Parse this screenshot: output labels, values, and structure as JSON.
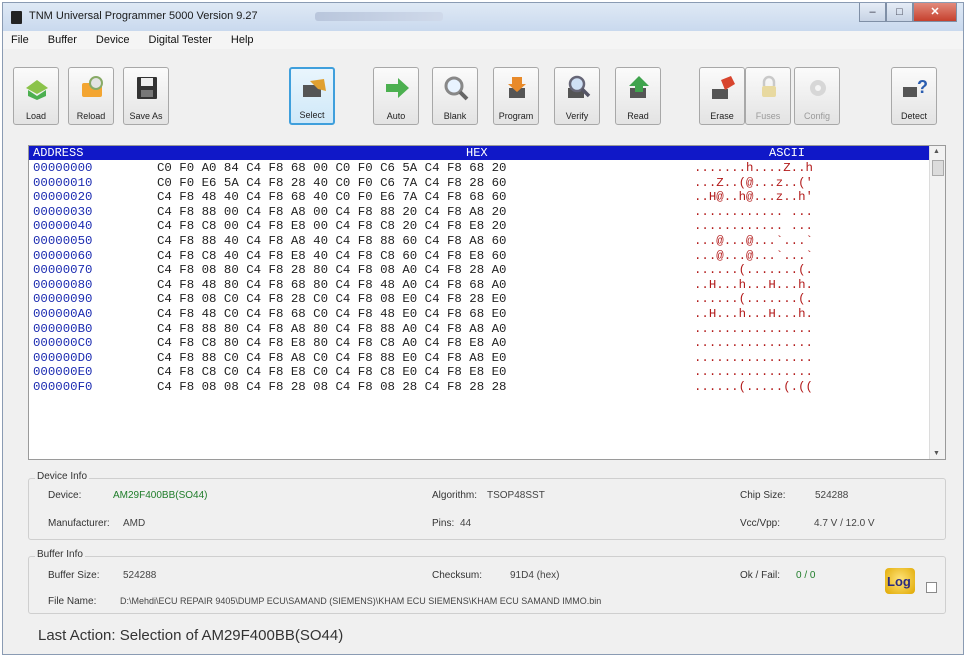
{
  "window": {
    "title": "TNM Universal Programmer 5000  Version 9.27",
    "controls": [
      "minimize",
      "maximize",
      "close"
    ]
  },
  "menu": [
    "File",
    "Buffer",
    "Device",
    "Digital Tester",
    "Help"
  ],
  "toolbar": [
    {
      "label": "Load",
      "icon": "load-icon",
      "enabled": true
    },
    {
      "label": "Reload",
      "icon": "reload-icon",
      "enabled": true
    },
    {
      "label": "Save As",
      "icon": "save-icon",
      "enabled": true
    },
    {
      "label": "Select",
      "icon": "select-chip-icon",
      "enabled": true,
      "active": true
    },
    {
      "label": "Auto",
      "icon": "arrow-right-icon",
      "enabled": true
    },
    {
      "label": "Blank",
      "icon": "magnifier-icon",
      "enabled": true
    },
    {
      "label": "Program",
      "icon": "program-icon",
      "enabled": true
    },
    {
      "label": "Verify",
      "icon": "verify-icon",
      "enabled": true
    },
    {
      "label": "Read",
      "icon": "read-icon",
      "enabled": true
    },
    {
      "label": "Erase",
      "icon": "erase-icon",
      "enabled": true
    },
    {
      "label": "Fuses",
      "icon": "lock-icon",
      "enabled": false
    },
    {
      "label": "Config",
      "icon": "gear-icon",
      "enabled": false
    },
    {
      "label": "Detect",
      "icon": "detect-icon",
      "enabled": true
    }
  ],
  "hex": {
    "headers": {
      "address": "ADDRESS",
      "hex": "HEX",
      "ascii": "ASCII"
    },
    "rows": [
      {
        "addr": "00000000",
        "hex": "C0 F0 A0 84 C4 F8 68 00 C0 F0 C6 5A C4 F8 68 20",
        "ascii": ".......h....Z..h"
      },
      {
        "addr": "00000010",
        "hex": "C0 F0 E6 5A C4 F8 28 40 C0 F0 C6 7A C4 F8 28 60",
        "ascii": "...Z..(@...z..('"
      },
      {
        "addr": "00000020",
        "hex": "C4 F8 48 40 C4 F8 68 40 C0 F0 E6 7A C4 F8 68 60",
        "ascii": "..H@..h@...z..h'"
      },
      {
        "addr": "00000030",
        "hex": "C4 F8 88 00 C4 F8 A8 00 C4 F8 88 20 C4 F8 A8 20",
        "ascii": "............ ..."
      },
      {
        "addr": "00000040",
        "hex": "C4 F8 C8 00 C4 F8 E8 00 C4 F8 C8 20 C4 F8 E8 20",
        "ascii": "............ ..."
      },
      {
        "addr": "00000050",
        "hex": "C4 F8 88 40 C4 F8 A8 40 C4 F8 88 60 C4 F8 A8 60",
        "ascii": "...@...@...`...`"
      },
      {
        "addr": "00000060",
        "hex": "C4 F8 C8 40 C4 F8 E8 40 C4 F8 C8 60 C4 F8 E8 60",
        "ascii": "...@...@...`...`"
      },
      {
        "addr": "00000070",
        "hex": "C4 F8 08 80 C4 F8 28 80 C4 F8 08 A0 C4 F8 28 A0",
        "ascii": "......(.......(."
      },
      {
        "addr": "00000080",
        "hex": "C4 F8 48 80 C4 F8 68 80 C4 F8 48 A0 C4 F8 68 A0",
        "ascii": "..H...h...H...h."
      },
      {
        "addr": "00000090",
        "hex": "C4 F8 08 C0 C4 F8 28 C0 C4 F8 08 E0 C4 F8 28 E0",
        "ascii": "......(.......(."
      },
      {
        "addr": "000000A0",
        "hex": "C4 F8 48 C0 C4 F8 68 C0 C4 F8 48 E0 C4 F8 68 E0",
        "ascii": "..H...h...H...h."
      },
      {
        "addr": "000000B0",
        "hex": "C4 F8 88 80 C4 F8 A8 80 C4 F8 88 A0 C4 F8 A8 A0",
        "ascii": "................"
      },
      {
        "addr": "000000C0",
        "hex": "C4 F8 C8 80 C4 F8 E8 80 C4 F8 C8 A0 C4 F8 E8 A0",
        "ascii": "................"
      },
      {
        "addr": "000000D0",
        "hex": "C4 F8 88 C0 C4 F8 A8 C0 C4 F8 88 E0 C4 F8 A8 E0",
        "ascii": "................"
      },
      {
        "addr": "000000E0",
        "hex": "C4 F8 C8 C0 C4 F8 E8 C0 C4 F8 C8 E0 C4 F8 E8 E0",
        "ascii": "................"
      },
      {
        "addr": "000000F0",
        "hex": "C4 F8 08 08 C4 F8 28 08 C4 F8 08 28 C4 F8 28 28",
        "ascii": "......(.....(.(("
      }
    ]
  },
  "device_info": {
    "group_label": "Device Info",
    "device_label": "Device:",
    "device": "AM29F400BB(SO44)",
    "manufacturer_label": "Manufacturer:",
    "manufacturer": "AMD",
    "algorithm_label": "Algorithm:",
    "algorithm": "TSOP48SST",
    "pins_label": "Pins:",
    "pins": "44",
    "chip_size_label": "Chip Size:",
    "chip_size": "524288",
    "vcc_label": "Vcc/Vpp:",
    "vcc": "4.7 V / 12.0 V"
  },
  "buffer_info": {
    "group_label": "Buffer Info",
    "buffer_size_label": "Buffer Size:",
    "buffer_size": "524288",
    "checksum_label": "Checksum:",
    "checksum": "91D4 (hex)",
    "okfail_label": "Ok / Fail:",
    "okfail": "0 / 0",
    "file_name_label": "File Name:",
    "file_name": "D:\\Mehdi\\ECU REPAIR 9405\\DUMP ECU\\SAMAND (SIEMENS)\\KHAM ECU SIEMENS\\KHAM ECU SAMAND IMMO.bin",
    "log_label": "Log"
  },
  "status": {
    "prefix": "Last Action:",
    "text": "Selection of  AM29F400BB(SO44)"
  },
  "colors": {
    "hex_header_bg": "#1018c8",
    "address_text": "#1a2ab0",
    "ascii_text": "#b21a1a",
    "device_value": "#1f7d2a",
    "active_button_border": "#3f9fdc"
  }
}
